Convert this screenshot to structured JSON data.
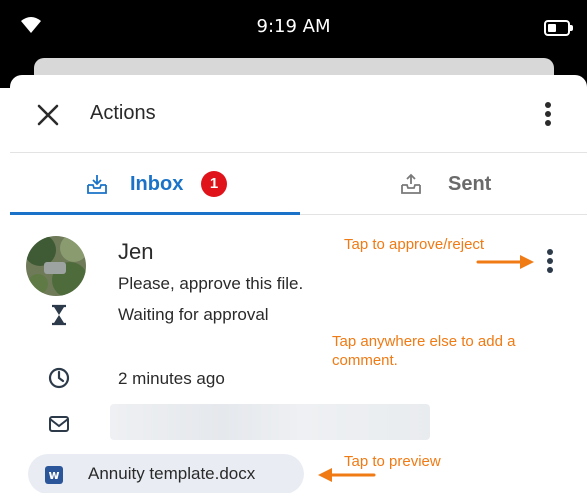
{
  "status_bar": {
    "time": "9:19 AM"
  },
  "header": {
    "title": "Actions"
  },
  "tabs": [
    {
      "label": "Inbox",
      "badge": "1",
      "selected": true
    },
    {
      "label": "Sent",
      "selected": false
    }
  ],
  "item": {
    "sender": "Jen",
    "message": "Please, approve this file.",
    "status": "Waiting for approval",
    "time": "2 minutes ago",
    "attachment": "Annuity template.docx",
    "attachment_icon_letter": "w"
  },
  "annotations": {
    "approve": "Tap to approve/reject",
    "comment": "Tap anywhere else to add a comment.",
    "preview": "Tap to preview"
  },
  "colors": {
    "accent": "#1a73c8",
    "badge": "#e0131a",
    "annotation": "#f07a14"
  }
}
